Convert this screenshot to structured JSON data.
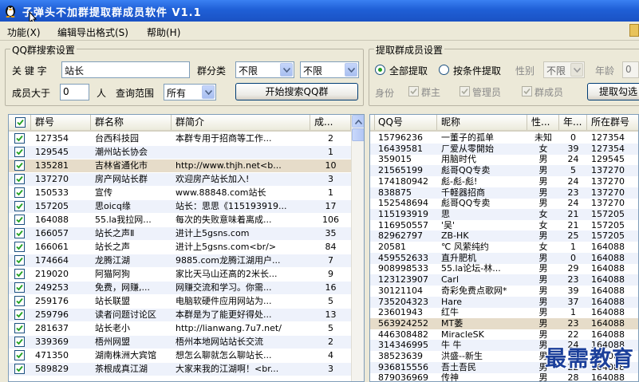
{
  "window": {
    "title": "子弹头不加群提取群成员软件   V1.1"
  },
  "menu": [
    {
      "label": "功能(X)"
    },
    {
      "label": "编辑导出格式(S)"
    },
    {
      "label": "帮助(H)"
    }
  ],
  "search_group": {
    "title": "QQ群搜索设置",
    "keyword_label": "关 键 字",
    "keyword_value": "站长",
    "category_label": "群分类",
    "category1_value": "不限",
    "category2_value": "不限",
    "members_gt_label": "成员大于",
    "members_gt_value": "0",
    "members_unit": "人",
    "scope_label": "查询范围",
    "scope_value": "所有",
    "search_button": "开始搜索QQ群"
  },
  "extract_group": {
    "title": "提取群成员设置",
    "radio_all": "全部提取",
    "radio_condition": "按条件提取",
    "gender_label": "性别",
    "gender_value": "不限",
    "age_label": "年龄",
    "age_value": "0",
    "identity_label": "身份",
    "chk_owner": "群主",
    "chk_admin": "管理员",
    "chk_member": "群成员",
    "extract_button": "提取勾选"
  },
  "groups_table": {
    "headers": [
      "群号",
      "群名称",
      "群简介",
      "成..."
    ],
    "rows": [
      [
        "127354",
        "台西科技园",
        "本群专用于招商等工作...",
        "2"
      ],
      [
        "129545",
        "潮州站长协会",
        "",
        "1"
      ],
      [
        "135281",
        "吉林省通化市",
        "http://www.thjh.net<b...",
        "10"
      ],
      [
        "137270",
        "房产网站长群",
        "欢迎房产站长加入!",
        "3"
      ],
      [
        "150533",
        "宣传",
        "www.88848.com站长",
        "1"
      ],
      [
        "157205",
        "思oicq缘",
        "站长：思思《115193919...",
        "17"
      ],
      [
        "164088",
        "55.la我拉网...",
        "每次的失败意味着离成...",
        "106"
      ],
      [
        "166057",
        "站长之声Ⅱ",
        "进计上5gsns.com",
        "35"
      ],
      [
        "166061",
        "站长之声",
        "进计上5gsns.com<br/>",
        "84"
      ],
      [
        "174664",
        "龙腾江湖",
        "9885.com龙腾江湖用户...",
        "7"
      ],
      [
        "219020",
        "阿猫阿狗",
        "家比天马山还高的2米长...",
        "9"
      ],
      [
        "249253",
        "免费，网赚,...",
        "网赚交流和学习。你需...",
        "16"
      ],
      [
        "259176",
        "站长联盟",
        "电脑软硬件应用网站为...",
        "5"
      ],
      [
        "259796",
        "读者问题讨论区",
        "本群是为了能更好得处...",
        "13"
      ],
      [
        "281637",
        "站长老小",
        "http://lianwang.7u7.net/",
        "5"
      ],
      [
        "339369",
        "梧州网盟",
        "梧州本地网站站长交流",
        "2"
      ],
      [
        "471350",
        "湖南株洲大宾馆",
        "想怎么聊就怎么聊站长...",
        "4"
      ],
      [
        "589829",
        "茶根成真江湖",
        "大家来我的江湖啊！<br...",
        "3"
      ]
    ]
  },
  "members_table": {
    "headers": [
      "QQ号",
      "昵称",
      "性...",
      "年...",
      "所在群号"
    ],
    "rows": [
      [
        "15796236",
        "一董子的孤单",
        "未知",
        "0",
        "127354"
      ],
      [
        "16439581",
        "ㄏ爱从零開始",
        "女",
        "39",
        "127354"
      ],
      [
        "359015",
        "用脑时代",
        "男",
        "24",
        "129545"
      ],
      [
        "21565199",
        "彪哥QQ专卖",
        "男",
        "5",
        "137270"
      ],
      [
        "174180942",
        "彪-彪-彪!",
        "男",
        "24",
        "137270"
      ],
      [
        "838875",
        "千軽器招商",
        "男",
        "23",
        "137270"
      ],
      [
        "152548694",
        "彪哥QQ专卖",
        "男",
        "24",
        "137270"
      ],
      [
        "115193919",
        "思",
        "女",
        "21",
        "157205"
      ],
      [
        "116950557",
        "'吴'",
        "女",
        "21",
        "157205"
      ],
      [
        "82962797",
        "ZB-HK",
        "男",
        "25",
        "157205"
      ],
      [
        "20581",
        "℃ 风萦纯约",
        "女",
        "1",
        "164088"
      ],
      [
        "459552633",
        "直升肥机",
        "男",
        "0",
        "164088"
      ],
      [
        "908998533",
        "55.la论坛-林...",
        "男",
        "29",
        "164088"
      ],
      [
        "123123907",
        "Carl",
        "男",
        "23",
        "164088"
      ],
      [
        "30121104",
        "奇彩免费点歌网*",
        "男",
        "39",
        "164088"
      ],
      [
        "735204323",
        "Hare",
        "男",
        "37",
        "164088"
      ],
      [
        "23601943",
        "红牛",
        "男",
        "1",
        "164088"
      ],
      [
        "563924252",
        "MT萎",
        "男",
        "23",
        "164088"
      ],
      [
        "446308482",
        "MiracleSK",
        "男",
        "22",
        "164088"
      ],
      [
        "314346995",
        "牛 牛",
        "男",
        "24",
        "164088"
      ],
      [
        "38523639",
        "洪盛--新生",
        "男",
        "23",
        "164088"
      ],
      [
        "936815556",
        "吾土吾民",
        "男",
        "22",
        "164088"
      ],
      [
        "879036969",
        "传神",
        "男",
        "28",
        "164088"
      ]
    ]
  },
  "watermark": "最需教育",
  "icons": {
    "app": "penguin-icon",
    "dropdown": "chevron-down-icon",
    "check": "checkmark-icon"
  },
  "colors": {
    "titlebar": "#1f5fd6",
    "row_alt": "#eef2fb",
    "row_highlight": "#e6dcc9",
    "watermark": "#1b3f9a"
  }
}
